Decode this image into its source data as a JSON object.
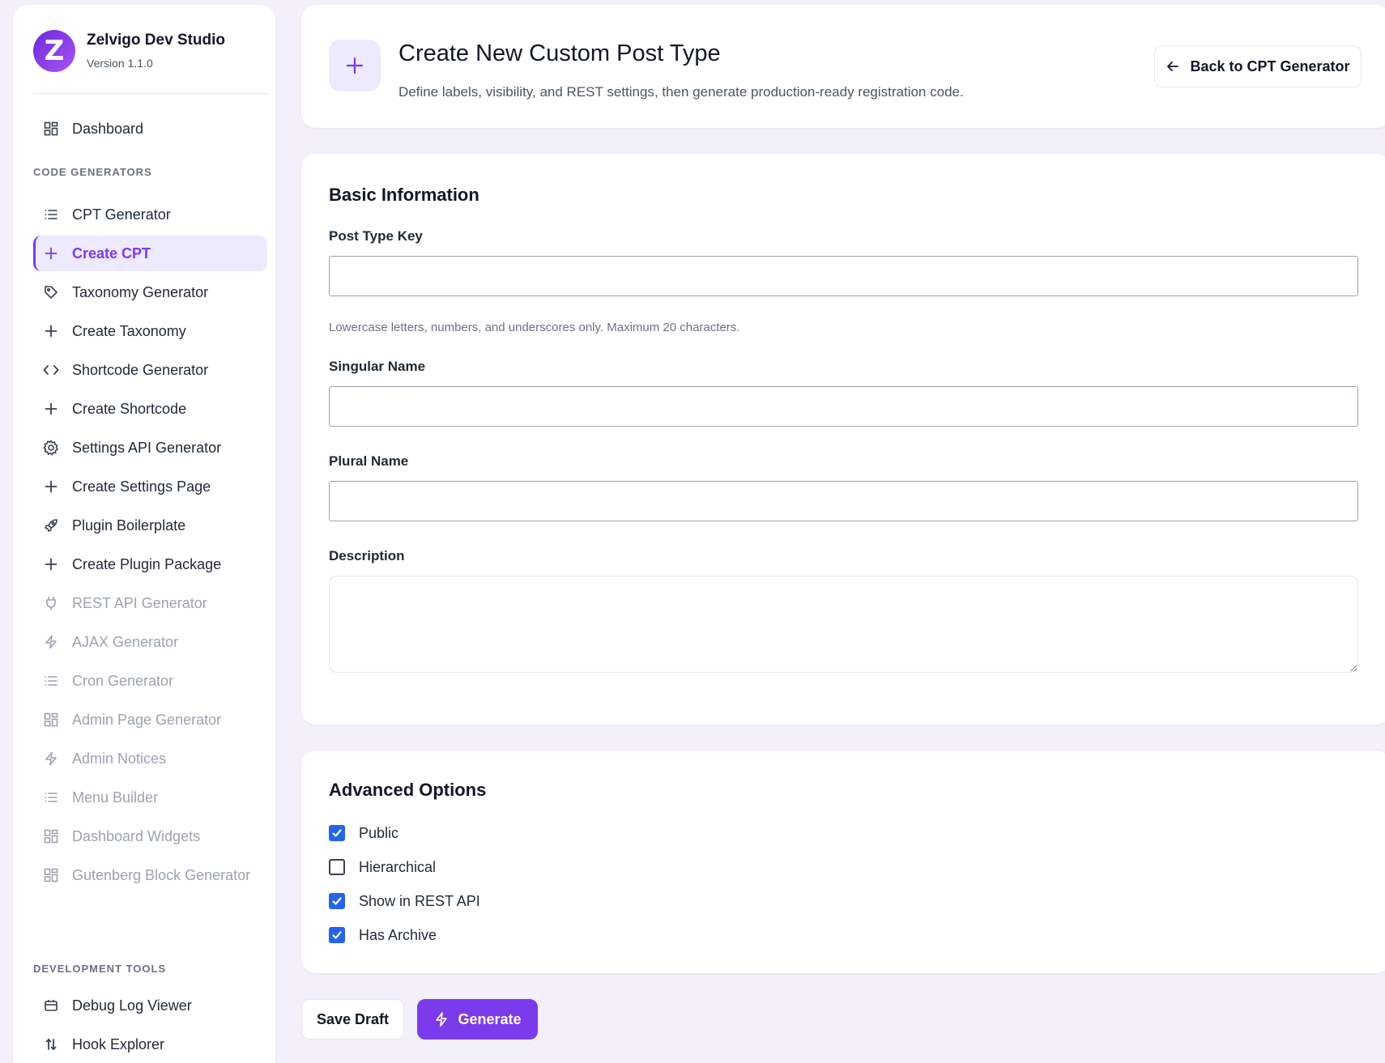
{
  "brand": {
    "name": "Zelvigo Dev Studio",
    "version": "Version 1.1.0",
    "logo_letter": "Z"
  },
  "sidebar": {
    "dashboard": {
      "label": "Dashboard",
      "icon": "grid-icon"
    },
    "sections": {
      "code_generators": "CODE GENERATORS",
      "development_tools": "DEVELOPMENT TOOLS"
    },
    "items": [
      {
        "label": "CPT Generator",
        "icon": "list-icon",
        "state": "normal"
      },
      {
        "label": "Create CPT",
        "icon": "plus-icon",
        "state": "active"
      },
      {
        "label": "Taxonomy Generator",
        "icon": "tag-icon",
        "state": "normal"
      },
      {
        "label": "Create Taxonomy",
        "icon": "plus-icon",
        "state": "normal"
      },
      {
        "label": "Shortcode Generator",
        "icon": "code-icon",
        "state": "normal"
      },
      {
        "label": "Create Shortcode",
        "icon": "plus-icon",
        "state": "normal"
      },
      {
        "label": "Settings API Generator",
        "icon": "gear-icon",
        "state": "normal"
      },
      {
        "label": "Create Settings Page",
        "icon": "plus-icon",
        "state": "normal"
      },
      {
        "label": "Plugin Boilerplate",
        "icon": "rocket-icon",
        "state": "normal"
      },
      {
        "label": "Create Plugin Package",
        "icon": "plus-icon",
        "state": "normal"
      },
      {
        "label": "REST API Generator",
        "icon": "plug-icon",
        "state": "muted"
      },
      {
        "label": "AJAX Generator",
        "icon": "bolt-icon",
        "state": "muted"
      },
      {
        "label": "Cron Generator",
        "icon": "list-icon",
        "state": "muted"
      },
      {
        "label": "Admin Page Generator",
        "icon": "grid-icon",
        "state": "muted"
      },
      {
        "label": "Admin Notices",
        "icon": "bolt-icon",
        "state": "muted"
      },
      {
        "label": "Menu Builder",
        "icon": "list-icon",
        "state": "muted"
      },
      {
        "label": "Dashboard Widgets",
        "icon": "grid-icon",
        "state": "muted"
      },
      {
        "label": "Gutenberg Block Generator",
        "icon": "grid-icon",
        "state": "muted"
      }
    ],
    "dev_tools": [
      {
        "label": "Debug Log Viewer",
        "icon": "calendar-icon"
      },
      {
        "label": "Hook Explorer",
        "icon": "sort-icon"
      }
    ]
  },
  "header": {
    "title": "Create New Custom Post Type",
    "subtitle": "Define labels, visibility, and REST settings, then generate production-ready registration code.",
    "back_label": "Back to CPT Generator"
  },
  "basic": {
    "title": "Basic Information",
    "post_type_key": {
      "label": "Post Type Key",
      "value": "",
      "help": "Lowercase letters, numbers, and underscores only. Maximum 20 characters."
    },
    "singular_name": {
      "label": "Singular Name",
      "value": ""
    },
    "plural_name": {
      "label": "Plural Name",
      "value": ""
    },
    "description": {
      "label": "Description",
      "value": ""
    }
  },
  "advanced": {
    "title": "Advanced Options",
    "options": [
      {
        "label": "Public",
        "checked": true
      },
      {
        "label": "Hierarchical",
        "checked": false
      },
      {
        "label": "Show in REST API",
        "checked": true
      },
      {
        "label": "Has Archive",
        "checked": true
      }
    ]
  },
  "actions": {
    "save_draft": "Save Draft",
    "generate": "Generate"
  },
  "colors": {
    "accent": "#7c3aed",
    "accent_light": "#ede9fe",
    "checkbox": "#2563eb",
    "background": "#f3f0fb"
  }
}
